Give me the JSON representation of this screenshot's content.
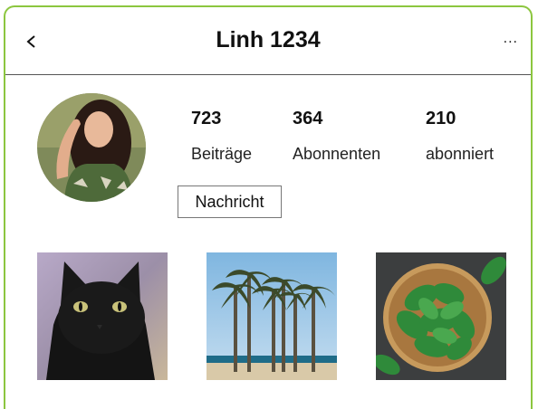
{
  "header": {
    "title": "Linh 1234",
    "more_label": "..."
  },
  "profile": {
    "stats": [
      {
        "value": "723",
        "label": "Beiträge"
      },
      {
        "value": "364",
        "label": "Abonnenten"
      },
      {
        "value": "210",
        "label": "abonniert"
      }
    ],
    "message_button": "Nachricht"
  },
  "posts": [
    {
      "subject": "black cat photo"
    },
    {
      "subject": "palm trees on beach photo"
    },
    {
      "subject": "spinach in wooden bowl photo"
    }
  ],
  "colors": {
    "frame_border": "#8cc63f",
    "header_divider": "#555555"
  }
}
